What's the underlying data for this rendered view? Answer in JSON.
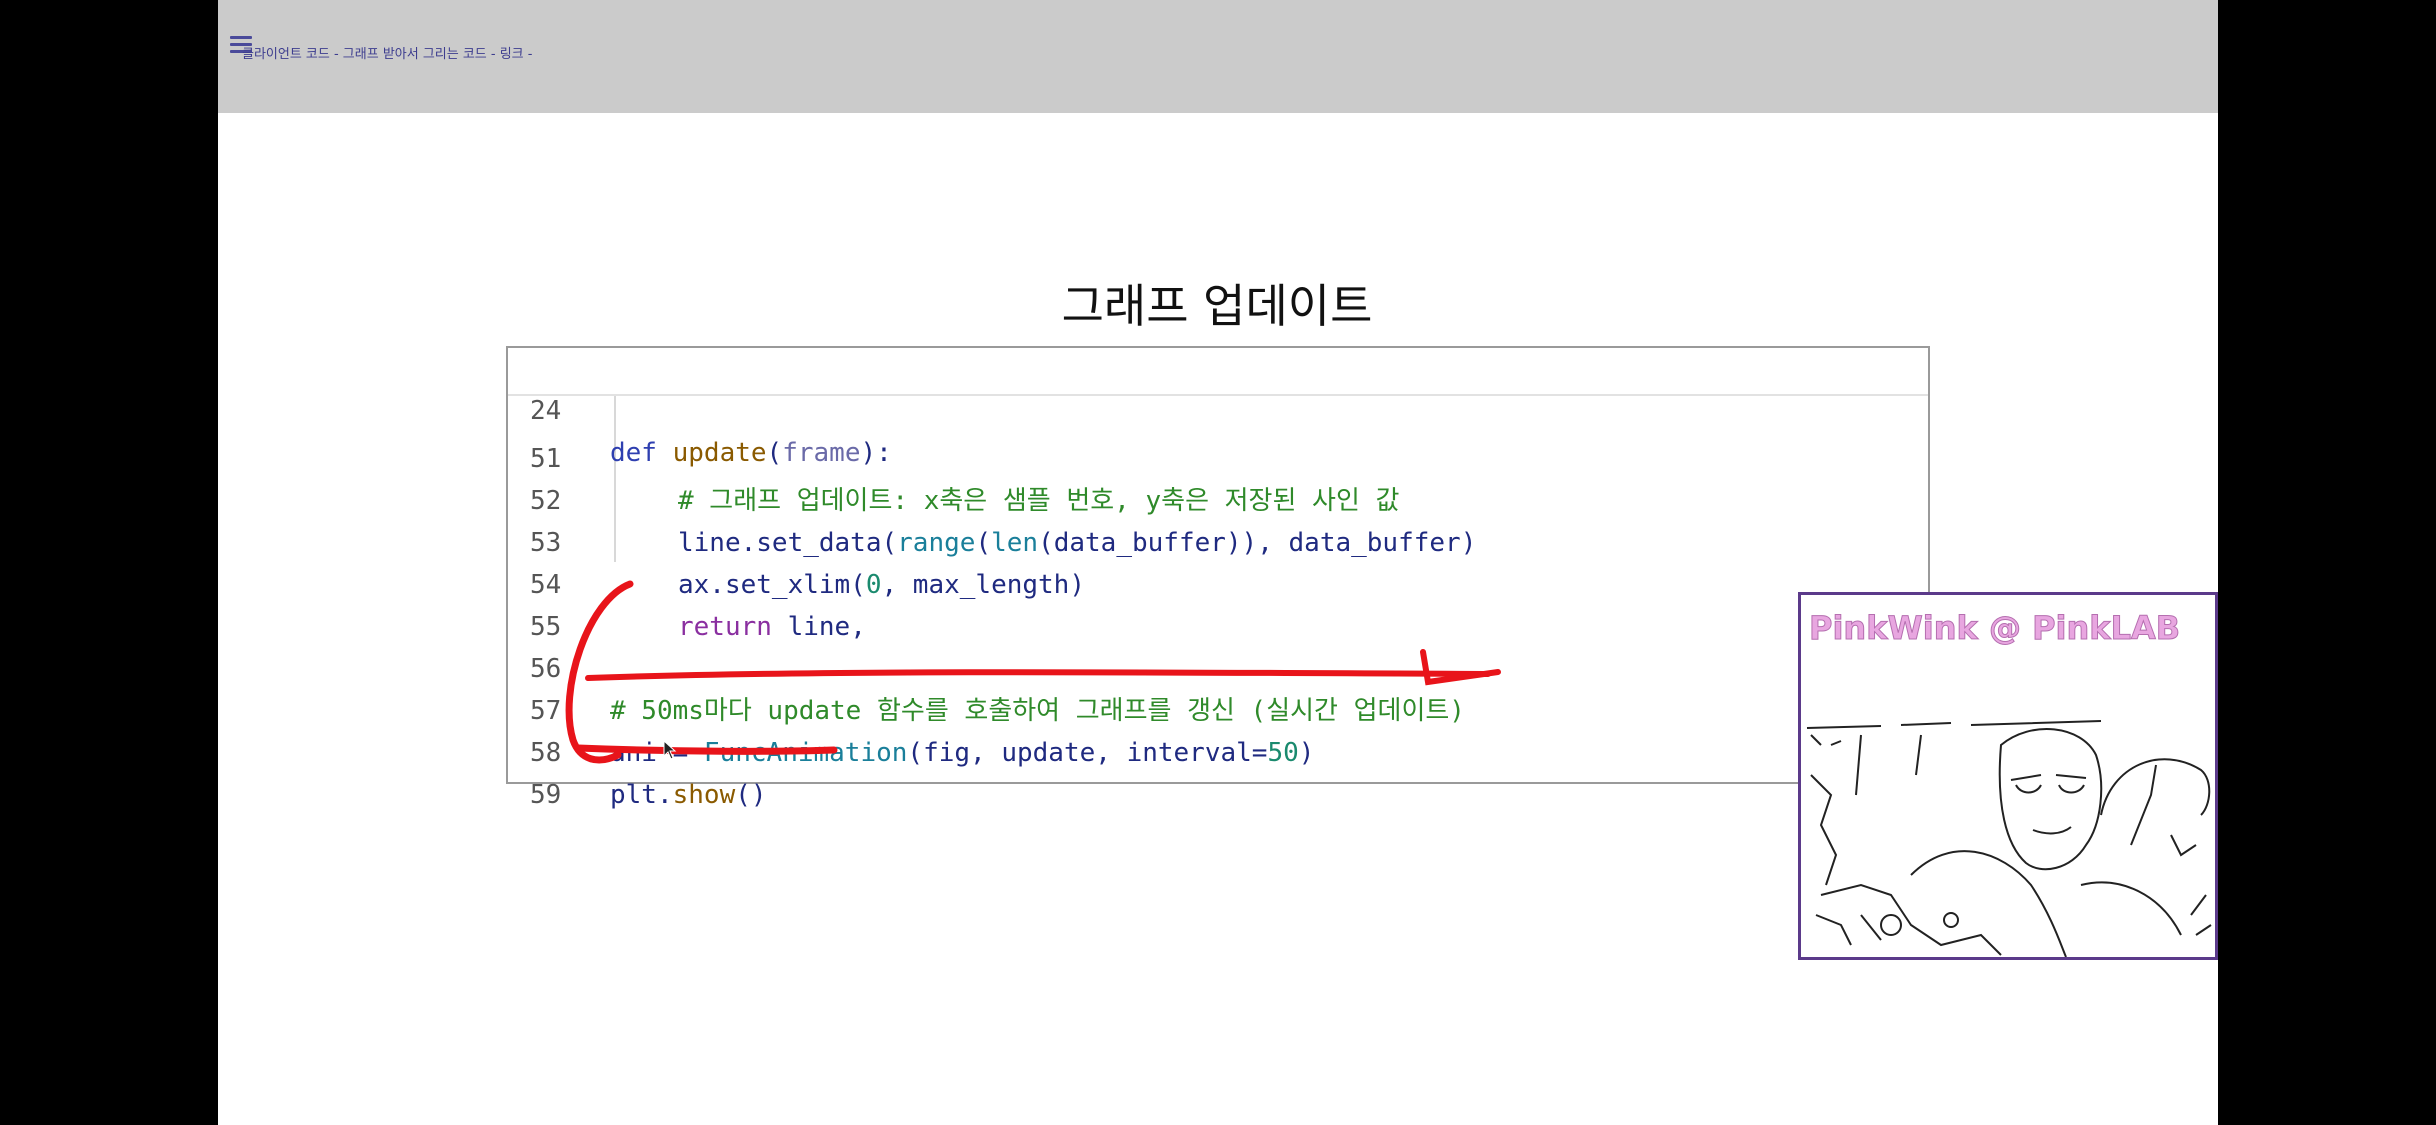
{
  "topbar": {
    "title": "클라이언트 코드 - 그래프 받아서 그리는 코드 - 링크 -"
  },
  "slide": {
    "heading": "그래프 업데이트"
  },
  "code": {
    "lines": [
      {
        "num": "24",
        "text": "def update(frame):"
      },
      {
        "num": "51",
        "text": "# 그래프 업데이트: x축은 샘플 번호, y축은 저장된 사인 값"
      },
      {
        "num": "52",
        "text": "line.set_data(range(len(data_buffer)), data_buffer)"
      },
      {
        "num": "53",
        "text": "ax.set_xlim(0, max_length)"
      },
      {
        "num": "54",
        "text": "return line,"
      },
      {
        "num": "55",
        "text": ""
      },
      {
        "num": "56",
        "text": "# 50ms마다 update 함수를 호출하여 그래프를 갱신 (실시간 업데이트)"
      },
      {
        "num": "57",
        "text": "ani = FuncAnimation(fig, update, interval=50)"
      },
      {
        "num": "58",
        "text": "plt.show()"
      },
      {
        "num": "59",
        "text": ""
      }
    ]
  },
  "webcam": {
    "label": "PinkWink @  PinkLAB"
  },
  "colors": {
    "annotation": "#e8141a",
    "slide_bg": "#ffffff",
    "topbar_bg": "#cbcbcb",
    "webcam_border": "#5b3a8a"
  }
}
